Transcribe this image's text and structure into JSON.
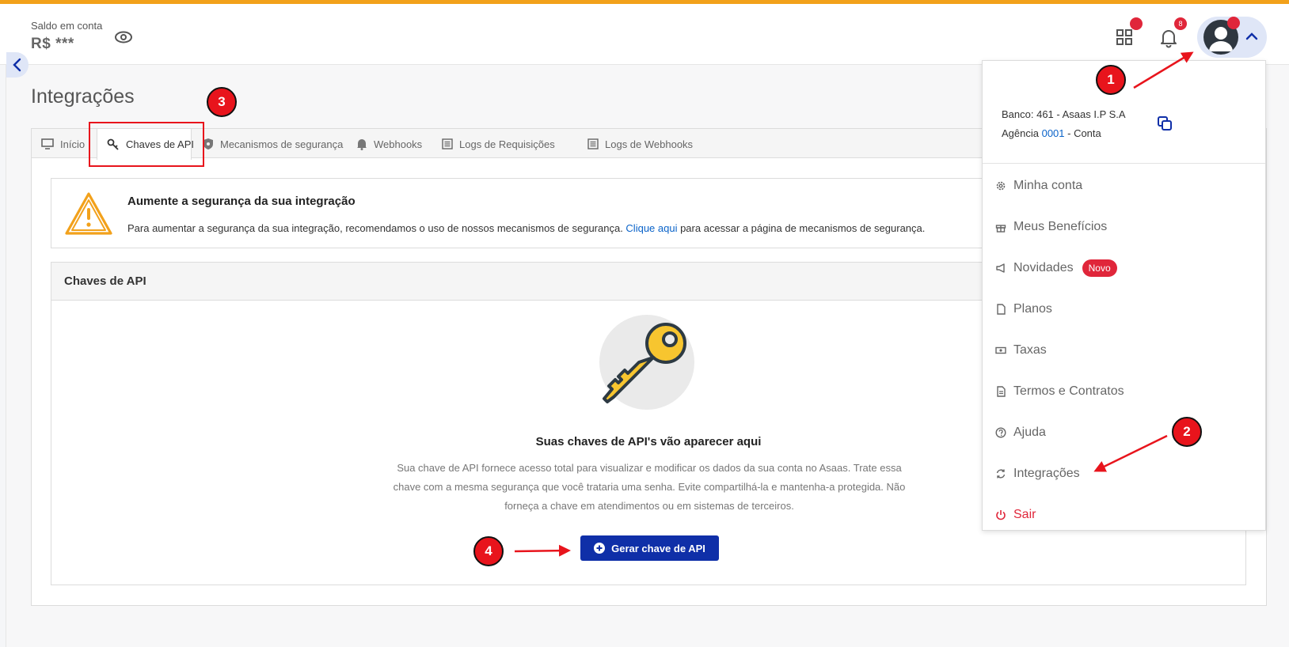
{
  "header": {
    "balance_label": "Saldo em conta",
    "balance_value": "R$ ***",
    "notifications_count": "8",
    "icons": [
      "eye-icon",
      "apps-grid-icon",
      "bell-icon",
      "avatar-icon",
      "chevron-up-icon"
    ]
  },
  "page": {
    "title": "Integrações"
  },
  "tabs": [
    {
      "label": "Início",
      "icon": "monitor-icon"
    },
    {
      "label": "Chaves de API",
      "icon": "key-icon",
      "active": true
    },
    {
      "label": "Mecanismos de segurança",
      "icon": "shield-icon"
    },
    {
      "label": "Webhooks",
      "icon": "bell-icon"
    },
    {
      "label": "Logs de Requisições",
      "icon": "list-icon"
    },
    {
      "label": "Logs de Webhooks",
      "icon": "list-icon"
    }
  ],
  "alert": {
    "title": "Aumente a segurança da sua integração",
    "text_before": "Para aumentar a segurança da sua integração, recomendamos o uso de nossos mecanismos de segurança. ",
    "link_text": "Clique aqui",
    "text_after": " para acessar a página de mecanismos de segurança.",
    "icon": "warning-icon"
  },
  "api_keys": {
    "section_title": "Chaves de API",
    "empty_title": "Suas chaves de API's vão aparecer aqui",
    "empty_text": "Sua chave de API fornece acesso total para visualizar e modificar os dados da sua conta no Asaas. Trate essa chave com a mesma segurança que você trataria uma senha. Evite compartilhá-la e mantenha-a protegida. Não forneça a chave em atendimentos ou em sistemas de terceiros.",
    "generate_button": "Gerar chave de API"
  },
  "account_menu": {
    "bank": "Banco: 461 - Asaas I.P S.A",
    "agency_prefix": "Agência ",
    "agency_number": "0001",
    "agency_suffix": " - Conta",
    "items": [
      {
        "label": "Minha conta",
        "icon": "gear-icon"
      },
      {
        "label": "Meus Benefícios",
        "icon": "gift-icon"
      },
      {
        "label": "Novidades",
        "icon": "megaphone-icon",
        "badge": "Novo"
      },
      {
        "label": "Planos",
        "icon": "document-icon"
      },
      {
        "label": "Taxas",
        "icon": "money-icon"
      },
      {
        "label": "Termos e Contratos",
        "icon": "file-icon"
      },
      {
        "label": "Ajuda",
        "icon": "help-icon"
      },
      {
        "label": "Integrações",
        "icon": "refresh-icon"
      },
      {
        "label": "Sair",
        "icon": "power-icon"
      }
    ]
  },
  "annotations": {
    "steps": [
      "1",
      "2",
      "3",
      "4"
    ],
    "color": "#e8141c"
  },
  "colors": {
    "accent_bar": "#f2a11b",
    "primary_button": "#0f2fa8",
    "alert_red": "#e0263a",
    "link": "#0a63c9"
  }
}
